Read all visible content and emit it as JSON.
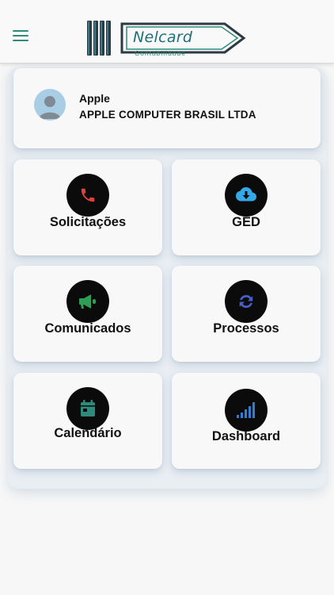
{
  "header": {
    "menu_icon": "hamburger-menu-icon",
    "logo": {
      "name": "Nelcard",
      "subtitle": "Contabilidade"
    }
  },
  "profile": {
    "avatar_icon": "user-avatar-icon",
    "name": "Apple",
    "company": "APPLE COMPUTER BRASIL LTDA"
  },
  "tiles": [
    {
      "label": "Solicitações",
      "icon": "phone-icon",
      "icon_color": "#e0413a"
    },
    {
      "label": "GED",
      "icon": "cloud-download-icon",
      "icon_color": "#35a9e8"
    },
    {
      "label": "Comunicados",
      "icon": "megaphone-icon",
      "icon_color": "#2e9e56"
    },
    {
      "label": "Processos",
      "icon": "sync-icon",
      "icon_color": "#4a5ec8"
    },
    {
      "label": "Calendário",
      "icon": "calendar-icon",
      "icon_color": "#2f8a7c"
    },
    {
      "label": "Dashboard",
      "icon": "signal-bars-icon",
      "icon_color": "#2d7fd6"
    }
  ],
  "colors": {
    "accent": "#2e8a7a",
    "background": "#f7f7f7",
    "card": "#f8f8f8",
    "icon_circle": "#0b0b0b"
  }
}
